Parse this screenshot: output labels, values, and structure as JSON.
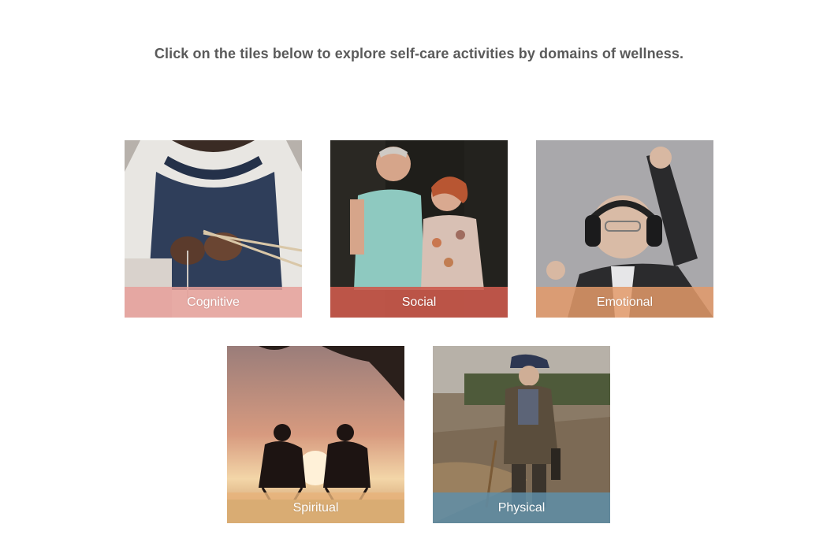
{
  "intro": {
    "text": "Click on the tiles below to explore self-care activities by domains of wellness."
  },
  "tiles": [
    {
      "id": "cognitive",
      "label": "Cognitive",
      "bar_color": "#e6a09a"
    },
    {
      "id": "social",
      "label": "Social",
      "bar_color": "#cc5a4c"
    },
    {
      "id": "emotional",
      "label": "Emotional",
      "bar_color": "#e39a6a"
    },
    {
      "id": "spiritual",
      "label": "Spiritual",
      "bar_color": "#e7b37a"
    },
    {
      "id": "physical",
      "label": "Physical",
      "bar_color": "#5f8ea8"
    }
  ]
}
